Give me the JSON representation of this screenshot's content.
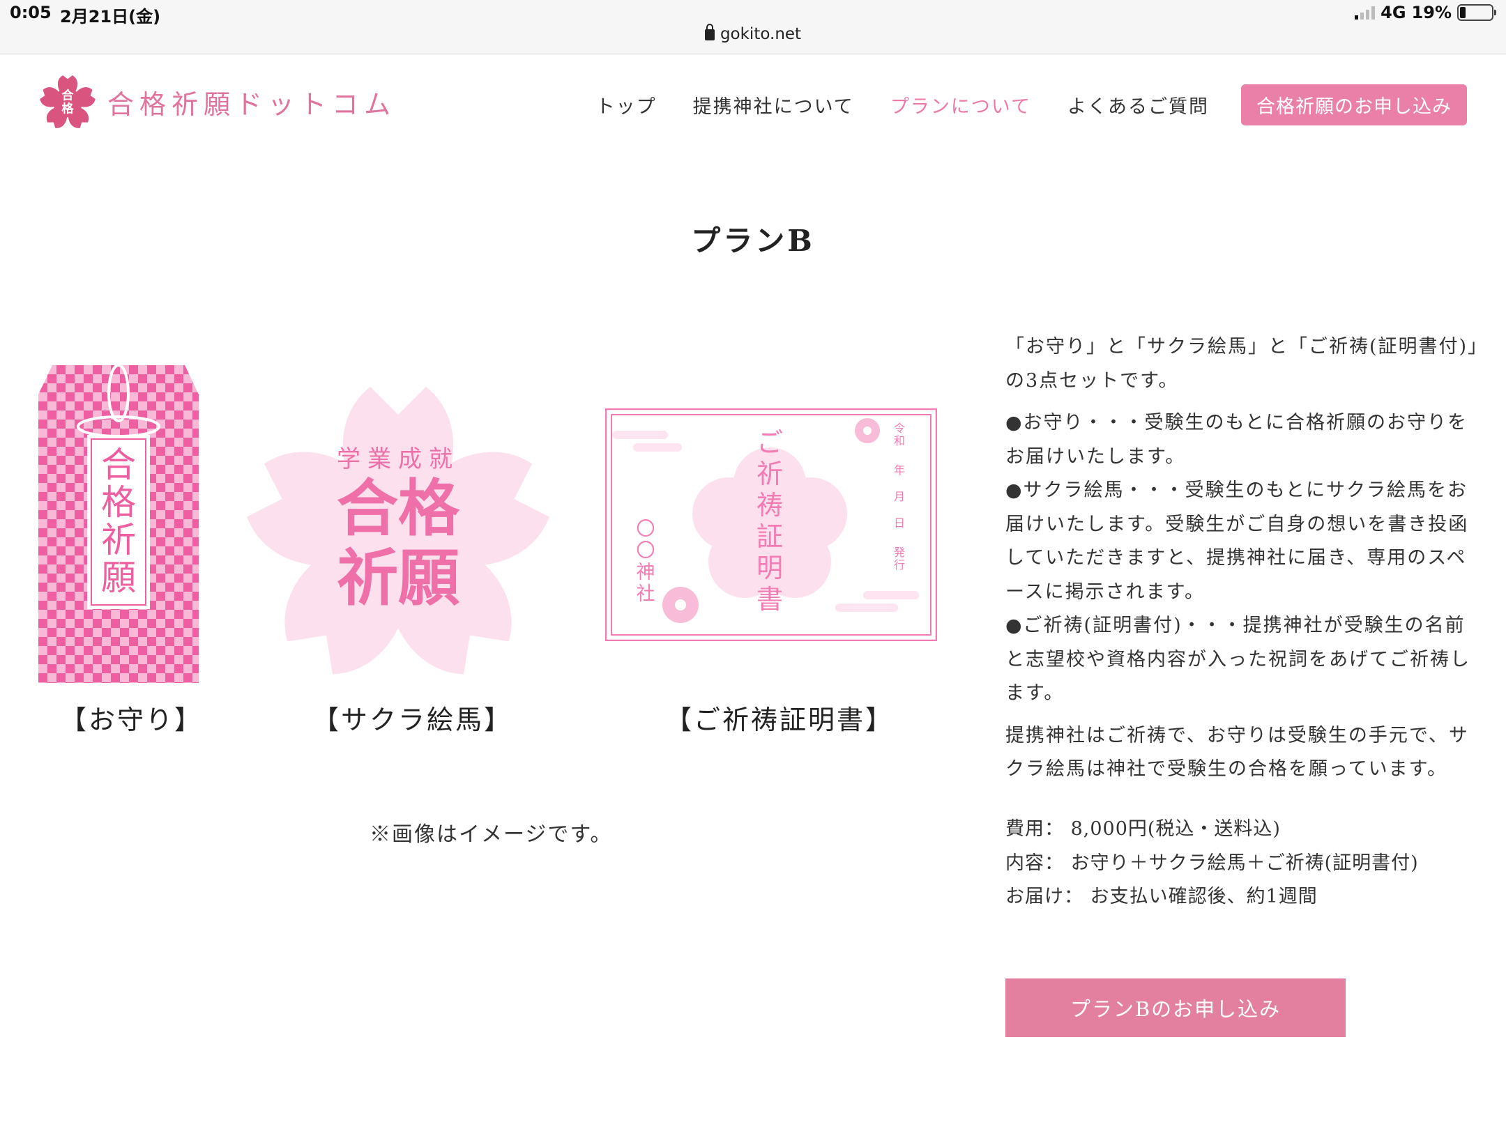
{
  "status": {
    "time": "0:05",
    "date": "2月21日(金)",
    "network": "4G",
    "battery": "19%",
    "battery_level": 0.19
  },
  "browser": {
    "url": "gokito.net"
  },
  "site": {
    "title": "合格祈願ドットコム",
    "logo_glyph_top": "合",
    "logo_glyph_bottom": "格",
    "accent_color": "#ec79a8"
  },
  "nav": {
    "items": [
      {
        "label": "トップ",
        "active": false
      },
      {
        "label": "提携神社について",
        "active": false
      },
      {
        "label": "プランについて",
        "active": true
      },
      {
        "label": "よくあるご質問",
        "active": false
      }
    ],
    "cta_label": "合格祈願のお申し込み"
  },
  "main": {
    "title": "プランB",
    "images": {
      "omamori": {
        "caption": "【お守り】",
        "text": [
          "合",
          "格",
          "祈",
          "願"
        ]
      },
      "ema": {
        "caption": "【サクラ絵馬】",
        "subtitle": "学業成就",
        "line1": "合格",
        "line2": "祈願"
      },
      "certificate": {
        "caption": "【ご祈祷証明書】",
        "title": [
          "ご",
          "祈",
          "祷",
          "証",
          "明",
          "書"
        ],
        "shrine": [
          "〇",
          "〇",
          "神",
          "社"
        ],
        "date": [
          "令",
          "和",
          "年",
          "月",
          "日",
          "発",
          "行"
        ]
      }
    },
    "image_note": "※画像はイメージです。",
    "description": {
      "intro": "「お守り」と「サクラ絵馬」と「ご祈祷(証明書付)」の3点セットです。",
      "item1": "●お守り・・・受験生のもとに合格祈願のお守りをお届けいたします。",
      "item2": "●サクラ絵馬・・・受験生のもとにサクラ絵馬をお届けいたします。受験生がご自身の想いを書き投函していただきますと、提携神社に届き、専用のスペースに掲示されます。",
      "item3": "●ご祈祷(証明書付)・・・提携神社が受験生の名前と志望校や資格内容が入った祝詞をあげてご祈祷します。",
      "summary": "提携神社はご祈祷で、お守りは受験生の手元で、サクラ絵馬は神社で受験生の合格を願っています。"
    },
    "specs": {
      "cost_label": "費用：",
      "cost_value": "8,000円(税込・送料込)",
      "contents_label": "内容：",
      "contents_value": "お守り＋サクラ絵馬＋ご祈祷(証明書付)",
      "delivery_label": "お届け：",
      "delivery_value": "お支払い確認後、約1週間"
    },
    "apply_label": "プランBのお申し込み"
  }
}
